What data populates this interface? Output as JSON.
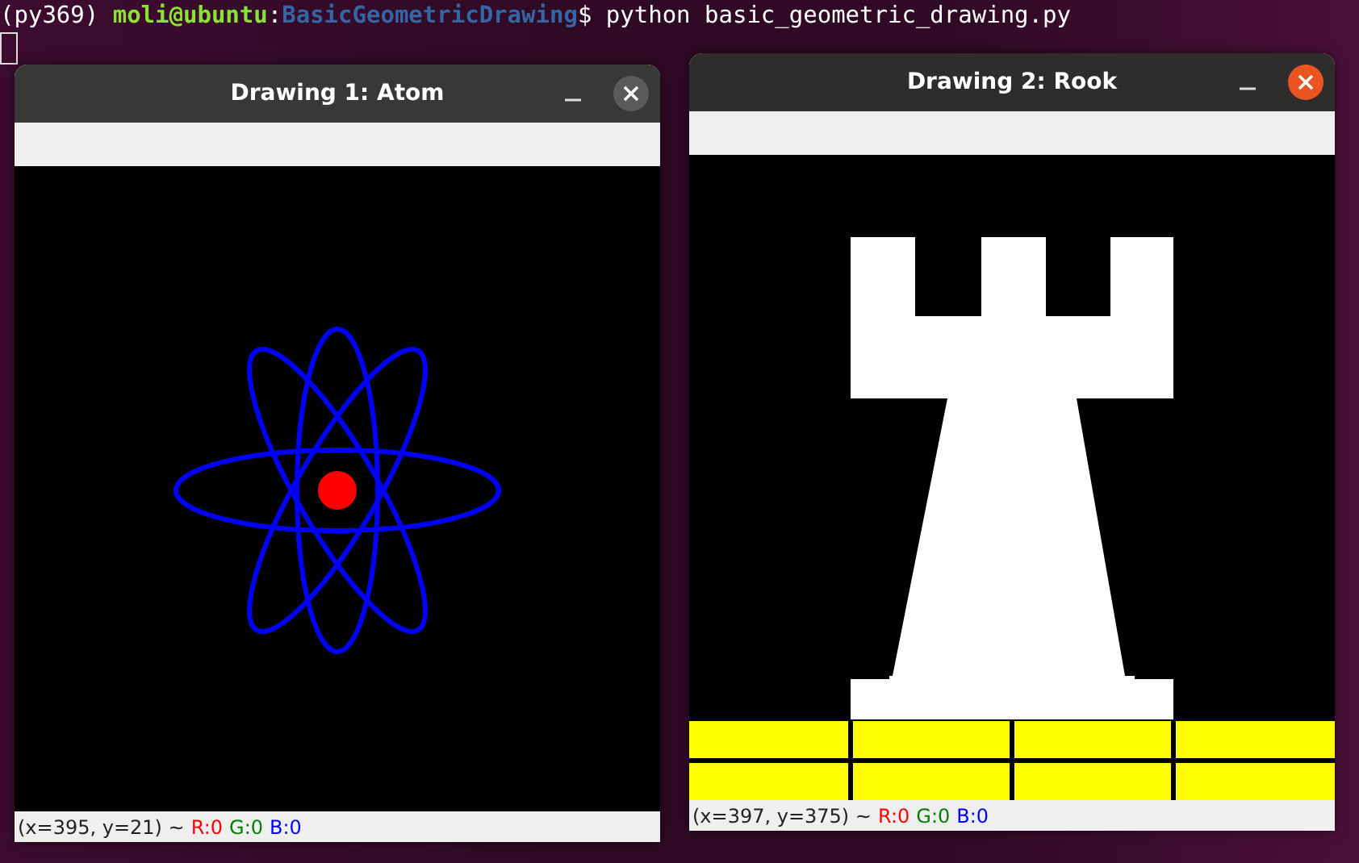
{
  "terminal": {
    "prompt_env": "(py369)",
    "prompt_user": "moli@ubuntu",
    "prompt_sep": ":",
    "prompt_path": "BasicGeometricDrawing",
    "prompt_end": "$",
    "command": "python basic_geometric_drawing.py"
  },
  "windows": [
    {
      "title": "Drawing 1: Atom",
      "active": false,
      "kind": "atom",
      "status": "(x=395, y=21) ~",
      "r": "R:0",
      "g": "G:0",
      "b": "B:0"
    },
    {
      "title": "Drawing 2: Rook",
      "active": true,
      "kind": "rook",
      "status": "(x=397, y=375) ~",
      "r": "R:0",
      "g": "G:0",
      "b": "B:0"
    }
  ]
}
